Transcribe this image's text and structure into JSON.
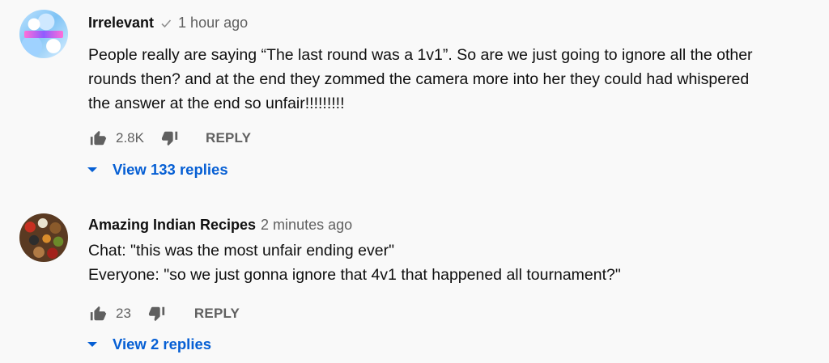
{
  "colors": {
    "background": "#f9f9f9",
    "author": "#0f0f0f",
    "meta": "#606060",
    "link": "#065fd4"
  },
  "comments": [
    {
      "author": "Irrelevant",
      "verified_icon": "check-icon",
      "time": "1 hour ago",
      "lines": [
        "People really are saying “The last round was a 1v1”. So are we just going to ignore all the other",
        "rounds then? and at the end they zommed the camera more into her they could had whispered",
        "the answer at the end so unfair!!!!!!!!!"
      ],
      "like_icon": "thumbs-up-icon",
      "likes": "2.8K",
      "dislike_icon": "thumbs-down-icon",
      "reply_label": "REPLY",
      "view_replies_icon": "caret-down-icon",
      "view_replies_label": "View 133 replies"
    },
    {
      "author": "Amazing Indian Recipes",
      "time": "2 minutes ago",
      "lines": [
        "Chat: \"this was the most unfair ending ever\"",
        "Everyone: \"so we just gonna ignore that 4v1 that happened all tournament?\""
      ],
      "like_icon": "thumbs-up-icon",
      "likes": "23",
      "dislike_icon": "thumbs-down-icon",
      "reply_label": "REPLY",
      "view_replies_icon": "caret-down-icon",
      "view_replies_label": "View 2 replies"
    }
  ]
}
